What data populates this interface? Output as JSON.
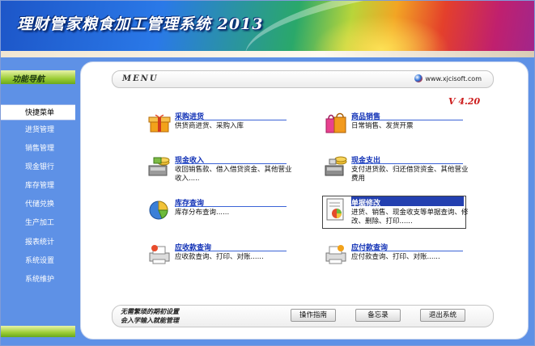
{
  "app": {
    "title": "理财管家粮食加工管理系统 2013"
  },
  "nav": {
    "header": "功能导航",
    "items": [
      {
        "label": "快捷菜单",
        "active": true
      },
      {
        "label": "进货管理",
        "active": false
      },
      {
        "label": "销售管理",
        "active": false
      },
      {
        "label": "现金银行",
        "active": false
      },
      {
        "label": "库存管理",
        "active": false
      },
      {
        "label": "代储兑换",
        "active": false
      },
      {
        "label": "生产加工",
        "active": false
      },
      {
        "label": "报表统计",
        "active": false
      },
      {
        "label": "系统设置",
        "active": false
      },
      {
        "label": "系统维护",
        "active": false
      }
    ]
  },
  "menu": {
    "label": "MENU",
    "site": "www.xjcisoft.com",
    "version": "V 4.20"
  },
  "modules": [
    {
      "title": "采购进货",
      "desc": "供货商进货、采购入库",
      "icon": "purchase-gift-icon"
    },
    {
      "title": "商品销售",
      "desc": "日常销售、发货开票",
      "icon": "shopping-bags-icon"
    },
    {
      "title": "现金收入",
      "desc": "收回销售款、借入借贷资金、其他营业收入.....",
      "icon": "cash-income-icon"
    },
    {
      "title": "现金支出",
      "desc": "支付进货款、归还借贷资金、其他营业费用",
      "icon": "cash-expense-icon"
    },
    {
      "title": "库存查询",
      "desc": "库存分布查询......",
      "icon": "pie-chart-icon"
    },
    {
      "title": "单据修改",
      "desc": "进货、销售、现金收支等单据查询、修改、删除、打印......",
      "icon": "document-chart-icon"
    },
    {
      "title": "应收款查询",
      "desc": "应收款查询、打印、对账......",
      "icon": "receivable-printer-icon"
    },
    {
      "title": "应付款查询",
      "desc": "应付款查询、打印、对账......",
      "icon": "payable-printer-icon"
    }
  ],
  "footer": {
    "tip_line1": "无需繁琐的期初设置",
    "tip_line2": "会入学输入就能管理",
    "buttons": [
      "操作指南",
      "备忘录",
      "退出系统"
    ]
  },
  "colors": {
    "nav_bg": "#5e91e6",
    "link": "#1232b6",
    "version": "#cc1b1b",
    "nav_header": "#9ccd36"
  }
}
